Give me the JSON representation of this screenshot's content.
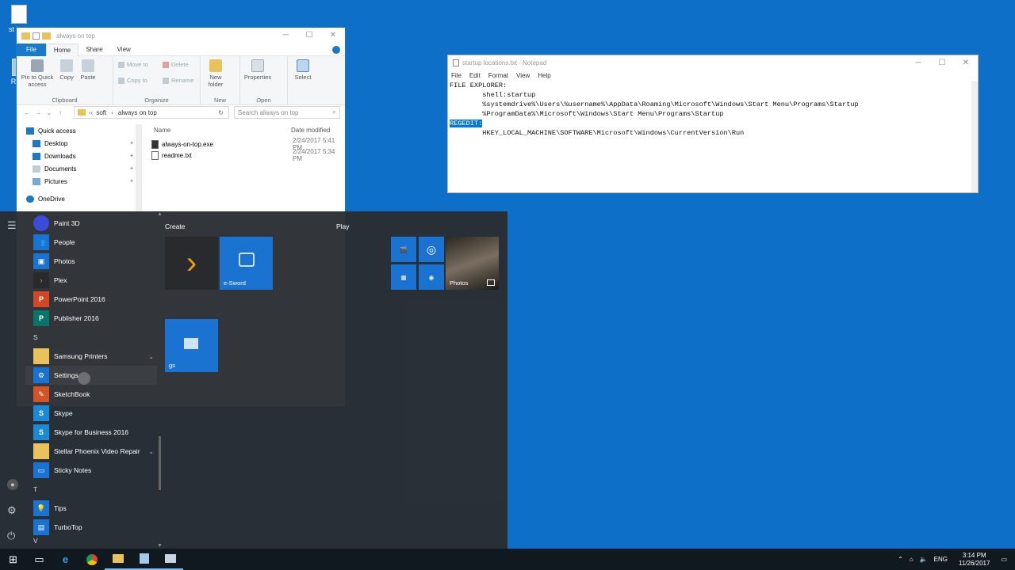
{
  "desktop": {
    "icons": [
      {
        "label": "st loca"
      },
      {
        "label": "Recy"
      }
    ]
  },
  "explorer": {
    "title": "always on top",
    "tabs": [
      "File",
      "Home",
      "Share",
      "View"
    ],
    "ribbon": {
      "clipboard": {
        "pin": "Pin to Quick access",
        "copy": "Copy",
        "paste": "Paste",
        "label": "Clipboard"
      },
      "organize": {
        "move_to": "Move to",
        "copy_to": "Copy to",
        "delete": "Delete",
        "rename": "Rename",
        "label": "Organize"
      },
      "new": {
        "new_folder": "New folder",
        "label": "New"
      },
      "open": {
        "properties": "Properties",
        "label": "Open"
      },
      "select": {
        "select": "Select"
      }
    },
    "address": {
      "crumbs": [
        "soft",
        "always on top"
      ],
      "search_placeholder": "Search always on top"
    },
    "nav": {
      "quick_access": "Quick access",
      "items": [
        "Desktop",
        "Downloads",
        "Documents",
        "Pictures"
      ],
      "onedrive": "OneDrive"
    },
    "columns": {
      "name": "Name",
      "date": "Date modified"
    },
    "files": [
      {
        "name": "always-on-top.exe",
        "date": "2/24/2017 5:41 PM"
      },
      {
        "name": "readme.txt",
        "date": "2/24/2017 5:34 PM"
      }
    ]
  },
  "notepad": {
    "title": "startup locations.txt - Notepad",
    "menu": [
      "File",
      "Edit",
      "Format",
      "View",
      "Help"
    ],
    "lines": [
      "FILE EXPLORER:",
      "        shell:startup",
      "        %systemdrive%\\Users\\%username%\\AppData\\Roaming\\Microsoft\\Windows\\Start Menu\\Programs\\Startup",
      "        %ProgramData%\\Microsoft\\Windows\\Start Menu\\Programs\\Startup",
      "",
      "        HKEY_LOCAL_MACHINE\\SOFTWARE\\Microsoft\\Windows\\CurrentVersion\\Run"
    ],
    "selected": "REGEDIT:"
  },
  "startmenu": {
    "apps_top": [
      {
        "name": "Paint 3D",
        "color": "#3a4cd8"
      },
      {
        "name": "People",
        "color": "#1a73d1"
      },
      {
        "name": "Photos",
        "color": "#1a73d1"
      },
      {
        "name": "Plex",
        "color": "#282a2d"
      },
      {
        "name": "PowerPoint 2016",
        "color": "#d24726"
      },
      {
        "name": "Publisher 2016",
        "color": "#077568"
      }
    ],
    "letter_s": "S",
    "apps_s": [
      {
        "name": "Samsung Printers",
        "color": "#e8c35c",
        "expand": true
      },
      {
        "name": "Settings",
        "color": "#1a73d1"
      },
      {
        "name": "SketchBook",
        "color": "#d2552a"
      },
      {
        "name": "Skype",
        "color": "#1a8ad4"
      },
      {
        "name": "Skype for Business 2016",
        "color": "#1a8ad4"
      },
      {
        "name": "Stellar Phoenix Video Repair",
        "color": "#e8c35c",
        "expand": true
      },
      {
        "name": "Sticky Notes",
        "color": "#1a73d1"
      }
    ],
    "letter_t": "T",
    "apps_t": [
      {
        "name": "Tips",
        "color": "#1a73d1"
      },
      {
        "name": "TurboTop",
        "color": "#1a73d1"
      }
    ],
    "letter_v": "V",
    "sections": {
      "create": "Create",
      "play": "Play"
    },
    "tiles": {
      "esword": "e-Sword",
      "gs": "gs",
      "photos": "Photos"
    }
  },
  "taskbar": {
    "lang": "ENG",
    "time": "3:14 PM",
    "date": "11/26/2017"
  }
}
